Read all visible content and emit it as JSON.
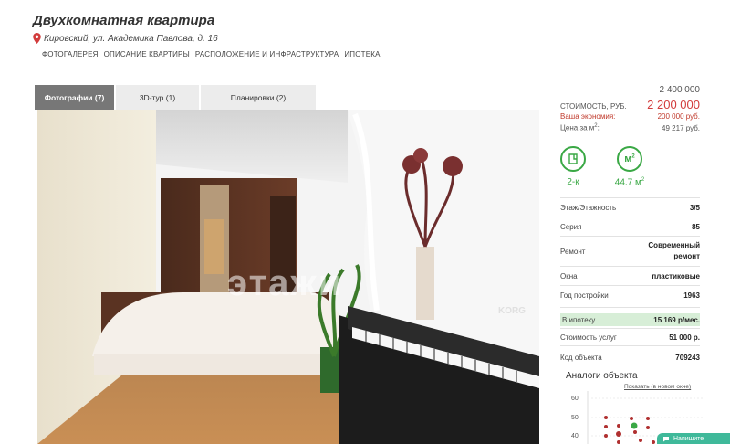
{
  "listing": {
    "title": "Двухкомнатная квартира",
    "address": "Кировский, ул. Академика Павлова, д. 16"
  },
  "nav": [
    "ФОТОГАЛЕРЕЯ",
    "ОПИСАНИЕ КВАРТИРЫ",
    "РАСПОЛОЖЕНИЕ И ИНФРАСТРУКТУРА",
    "ИПОТЕКА"
  ],
  "tabs": [
    {
      "label": "Фотографии (7)",
      "active": true
    },
    {
      "label": "3D-тур (1)",
      "active": false
    },
    {
      "label": "Планировки (2)",
      "active": false
    }
  ],
  "photo": {
    "watermark": "этажи",
    "piano_brand": "KORG"
  },
  "price": {
    "old": "2 400 000",
    "label": "СТОИМОСТЬ, РУБ.",
    "value": "2 200 000",
    "savings_label": "Ваша экономия:",
    "savings_value": "200 000 руб.",
    "per_m2_label": "Цена за м",
    "per_m2_sup": "2",
    "per_m2_value": "49 217 руб."
  },
  "badges": {
    "rooms_label": "2-к",
    "area_icon_text": "м",
    "area_icon_sup": "2",
    "area_value": "44.7 м",
    "area_sup": "2"
  },
  "features": [
    {
      "label": "Этаж/Этажность",
      "value": "3/5"
    },
    {
      "label": "Серия",
      "value": "85"
    },
    {
      "label": "Ремонт",
      "value": "Современный ремонт"
    },
    {
      "label": "Окна",
      "value": "пластиковые"
    },
    {
      "label": "Год постройки",
      "value": "1963"
    },
    {
      "label": "В ипотеку",
      "value": "15 169 р/мес."
    },
    {
      "label": "Стоимость услуг",
      "value": "51 000 р."
    },
    {
      "label": "Код объекта",
      "value": "709243"
    }
  ],
  "analogs": {
    "title": "Аналоги объекта",
    "link": "Показать (в новом окне)",
    "y_ticks": [
      "60",
      "50",
      "40"
    ]
  },
  "chat": {
    "label": "Напишите"
  },
  "colors": {
    "accent_green": "#3aa845",
    "price_red": "#d23c3c",
    "tab_active": "#777777",
    "highlight": "#d7eed7"
  }
}
